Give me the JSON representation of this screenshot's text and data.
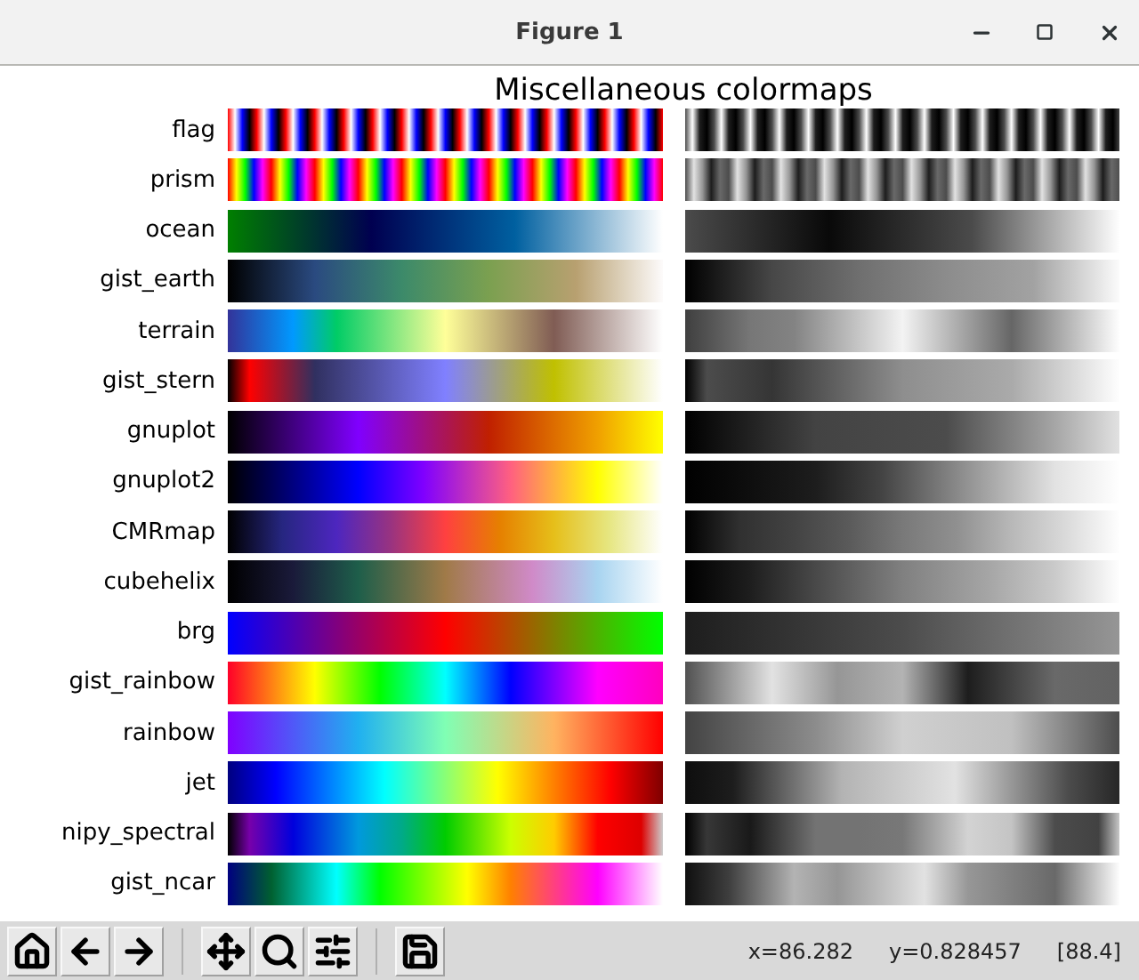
{
  "window": {
    "title": "Figure 1"
  },
  "figure": {
    "title": "Miscellaneous colormaps"
  },
  "colormaps": [
    {
      "name": "flag"
    },
    {
      "name": "prism"
    },
    {
      "name": "ocean"
    },
    {
      "name": "gist_earth"
    },
    {
      "name": "terrain"
    },
    {
      "name": "gist_stern"
    },
    {
      "name": "gnuplot"
    },
    {
      "name": "gnuplot2"
    },
    {
      "name": "CMRmap"
    },
    {
      "name": "cubehelix"
    },
    {
      "name": "brg"
    },
    {
      "name": "gist_rainbow"
    },
    {
      "name": "rainbow"
    },
    {
      "name": "jet"
    },
    {
      "name": "nipy_spectral"
    },
    {
      "name": "gist_ncar"
    }
  ],
  "status": [
    "x=86.282",
    "y=0.828457",
    "[88.4]"
  ]
}
